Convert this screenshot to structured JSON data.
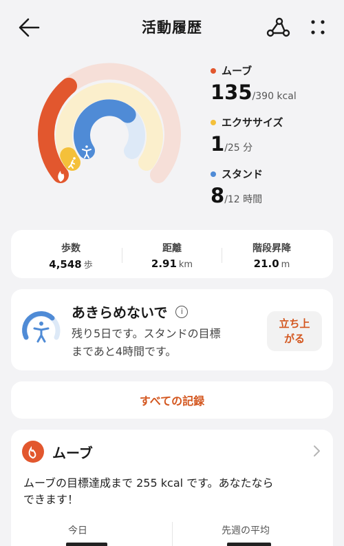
{
  "header": {
    "title": "活動履歴"
  },
  "colors": {
    "move": "#e2572e",
    "exercise": "#f4c03a",
    "stand": "#4f8bd6",
    "accent": "#d3561e"
  },
  "rings": {
    "move_fraction": 0.346,
    "exercise_fraction": 0.04,
    "stand_fraction": 0.667
  },
  "stats": {
    "move": {
      "label": "ムーブ",
      "value": "135",
      "goal": "/390 kcal"
    },
    "exercise": {
      "label": "エクササイズ",
      "value": "1",
      "goal": "/25 分"
    },
    "stand": {
      "label": "スタンド",
      "value": "8",
      "goal": "/12 時間"
    }
  },
  "metrics": [
    {
      "label": "歩数",
      "value": "4,548",
      "unit": "歩"
    },
    {
      "label": "距離",
      "value": "2.91",
      "unit": "km"
    },
    {
      "label": "階段昇降",
      "value": "21.0",
      "unit": "m"
    }
  ],
  "encourage": {
    "title": "あきらめないで",
    "info_icon": "i",
    "line1": "残り5日です。スタンドの目標",
    "line2": "まであと4時間です。",
    "button_line1": "立ち上",
    "button_line2": "がる"
  },
  "all_records": "すべての記録",
  "move_card": {
    "title": "ムーブ",
    "desc_line1": "ムーブの目標達成まで 255 kcal です。あなたなら",
    "desc_line2": "できます！",
    "today_label": "今日",
    "lastweek_label": "先週の平均"
  }
}
